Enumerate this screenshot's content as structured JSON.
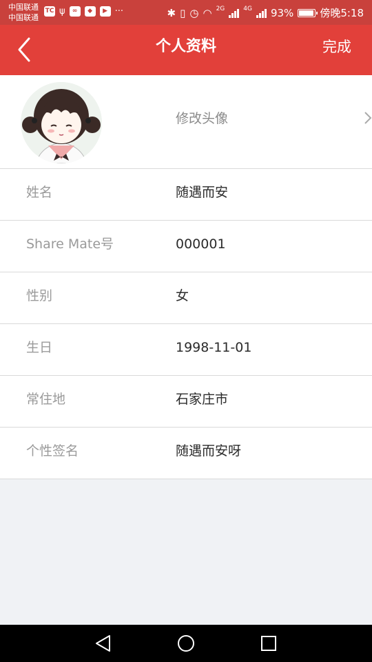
{
  "status_bar": {
    "carrier_1": "中国联通",
    "carrier_2": "中国联通",
    "network_1": "2G",
    "network_2": "4G",
    "battery": "93%",
    "time": "傍晚5:18",
    "more": "···"
  },
  "header": {
    "title": "个人资料",
    "done_label": "完成"
  },
  "avatar_row": {
    "change_label": "修改头像"
  },
  "fields": [
    {
      "label": "姓名",
      "value": "随遇而安"
    },
    {
      "label": "Share Mate号",
      "value": "000001"
    },
    {
      "label": "性别",
      "value": "女"
    },
    {
      "label": "生日",
      "value": "1998-11-01"
    },
    {
      "label": "常住地",
      "value": "石家庄市"
    },
    {
      "label": "个性签名",
      "value": "随遇而安呀"
    }
  ],
  "colors": {
    "header": "#e2403a",
    "status_bar": "#c9413c",
    "background": "#f0f2f5"
  }
}
